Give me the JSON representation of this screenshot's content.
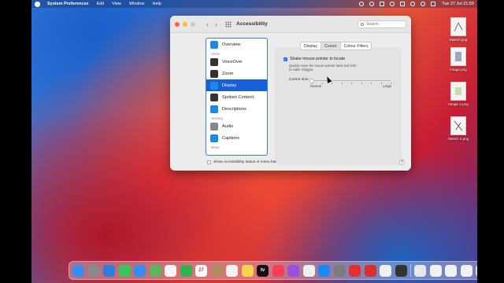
{
  "menubar": {
    "app_name": "System Preferences",
    "items": [
      "Edit",
      "View",
      "Window",
      "Help"
    ],
    "clock": "Tue 27 Jul  21:59"
  },
  "window": {
    "title": "Accessibility",
    "search_placeholder": "Search"
  },
  "sidebar": {
    "top_item": {
      "label": "Overview",
      "icon": "overview-icon",
      "color": "#1e88e5"
    },
    "sections": [
      {
        "title": "Vision",
        "items": [
          {
            "label": "VoiceOver",
            "icon": "voiceover-icon",
            "color": "#333333"
          },
          {
            "label": "Zoom",
            "icon": "zoom-icon",
            "color": "#333333"
          },
          {
            "label": "Display",
            "icon": "display-icon",
            "color": "#1e88e5",
            "selected": true
          },
          {
            "label": "Spoken Content",
            "icon": "spoken-content-icon",
            "color": "#333333"
          },
          {
            "label": "Descriptions",
            "icon": "descriptions-icon",
            "color": "#1e88e5"
          }
        ]
      },
      {
        "title": "Hearing",
        "items": [
          {
            "label": "Audio",
            "icon": "audio-icon",
            "color": "#888888"
          },
          {
            "label": "Captions",
            "icon": "captions-icon",
            "color": "#1e88e5"
          }
        ]
      },
      {
        "title": "Motor",
        "items": []
      }
    ]
  },
  "tabs": [
    {
      "label": "Display",
      "active": false
    },
    {
      "label": "Cursor",
      "active": true
    },
    {
      "label": "Colour Filters",
      "active": false
    }
  ],
  "cursor_pane": {
    "shake_label": "Shake mouse pointer to locate",
    "shake_checked": true,
    "shake_description": "Quickly move the mouse pointer back and forth to make it bigger.",
    "cursor_size_label": "Cursor size:",
    "slider_min_label": "Normal",
    "slider_max_label": "Large",
    "slider_value": 0
  },
  "footer": {
    "status_label": "Show Accessibility status in menu bar",
    "status_checked": false,
    "help": "?"
  },
  "desktop_files": [
    {
      "name": "Sketch.png"
    },
    {
      "name": "Image.png"
    },
    {
      "name": "Image 2.png"
    },
    {
      "name": "Sketch 2.png"
    }
  ],
  "dock": {
    "icons": [
      {
        "name": "finder",
        "color": "#3b8cf0"
      },
      {
        "name": "launchpad",
        "color": "#8a8a8a"
      },
      {
        "name": "safari",
        "color": "#2a7de1"
      },
      {
        "name": "messages",
        "color": "#34c759"
      },
      {
        "name": "mail",
        "color": "#2f8ff5"
      },
      {
        "name": "maps",
        "color": "#5bb65c"
      },
      {
        "name": "photos",
        "color": "#f6f6f6"
      },
      {
        "name": "facetime",
        "color": "#2fb352"
      },
      {
        "name": "calendar",
        "color": "#ffffff",
        "text": "27"
      },
      {
        "name": "contacts",
        "color": "#b48b5d"
      },
      {
        "name": "reminders",
        "color": "#f2f2f2"
      },
      {
        "name": "notes",
        "color": "#f5d54a"
      },
      {
        "name": "tv",
        "color": "#111111",
        "text": "tv"
      },
      {
        "name": "music",
        "color": "#fa3c55"
      },
      {
        "name": "podcasts",
        "color": "#9a4fe0"
      },
      {
        "name": "news",
        "color": "#f0f0f0"
      },
      {
        "name": "app-store",
        "color": "#1b8af2"
      },
      {
        "name": "system-preferences",
        "color": "#7c7c7c"
      },
      {
        "name": "mail-2",
        "color": "#e5312e"
      },
      {
        "name": "photo-booth",
        "color": "#d7312c"
      },
      {
        "name": "chrome",
        "color": "#f0f0f0"
      },
      {
        "name": "sketch-app",
        "color": "#333333"
      }
    ],
    "right_icons": [
      {
        "name": "downloads-stack",
        "color": "#e8e8ec"
      },
      {
        "name": "screenshot-1",
        "color": "#f1f1f3"
      },
      {
        "name": "screenshot-2",
        "color": "#f1f1f3"
      },
      {
        "name": "screenshot-3",
        "color": "#f1f1f3"
      },
      {
        "name": "trash",
        "color": "#d8d8d8"
      }
    ]
  }
}
